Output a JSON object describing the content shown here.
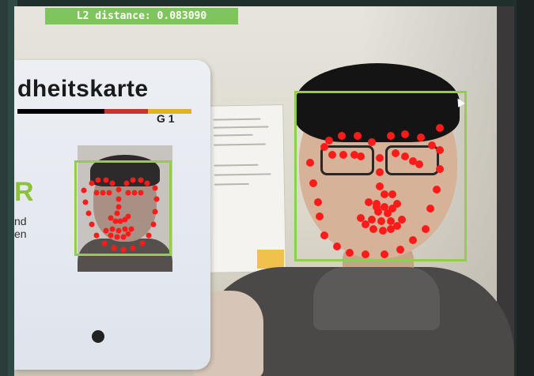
{
  "overlay": {
    "distance_label": "L2 distance: 0.083090",
    "box_color": "#8dd04f",
    "landmark_color": "#ff1a1a",
    "label_bg_color": "#7ec65c"
  },
  "card": {
    "title": "dheitskarte",
    "code": "G 1",
    "letter": "R",
    "text_line1": "nd",
    "text_line2": "en"
  },
  "icons": {
    "cursor": "mouse-pointer-icon",
    "card_logo": "seal-icon"
  }
}
